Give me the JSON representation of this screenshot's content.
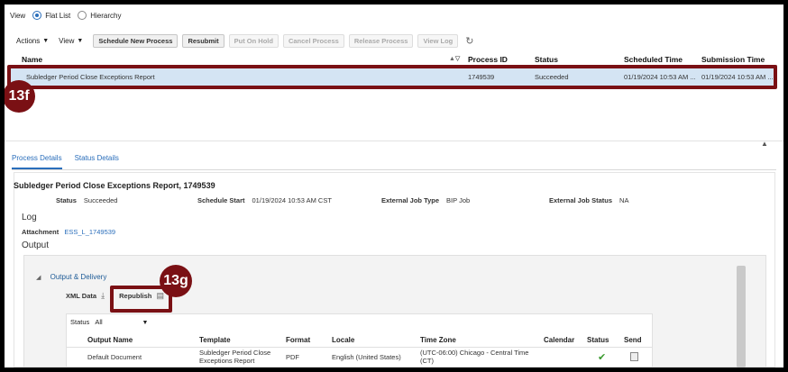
{
  "view": {
    "label": "View",
    "options": [
      {
        "label": "Flat List",
        "selected": true
      },
      {
        "label": "Hierarchy",
        "selected": false
      }
    ]
  },
  "toolbar": {
    "actions_menu": "Actions",
    "view_menu": "View",
    "buttons": [
      {
        "label": "Schedule New Process",
        "enabled": true
      },
      {
        "label": "Resubmit",
        "enabled": true
      },
      {
        "label": "Put On Hold",
        "enabled": false
      },
      {
        "label": "Cancel Process",
        "enabled": false
      },
      {
        "label": "Release Process",
        "enabled": false
      },
      {
        "label": "View Log",
        "enabled": false
      }
    ]
  },
  "grid": {
    "columns": [
      "Name",
      "Process ID",
      "Status",
      "Scheduled Time",
      "Submission Time"
    ],
    "rows": [
      {
        "name": "Subledger Period Close Exceptions Report",
        "process_id": "1749539",
        "status": "Succeeded",
        "scheduled_time": "01/19/2024 10:53 AM ...",
        "submission_time": "01/19/2024 10:53 AM ..."
      }
    ]
  },
  "callouts": {
    "step_f": "13f",
    "step_g": "13g"
  },
  "tabs": [
    {
      "label": "Process Details",
      "active": true
    },
    {
      "label": "Status Details",
      "active": false
    }
  ],
  "details": {
    "title": "Subledger Period Close Exceptions Report, 1749539",
    "status_label": "Status",
    "status_value": "Succeeded",
    "schedule_start_label": "Schedule Start",
    "schedule_start_value": "01/19/2024 10:53 AM CST",
    "external_job_type_label": "External Job Type",
    "external_job_type_value": "BIP Job",
    "external_job_status_label": "External Job Status",
    "external_job_status_value": "NA",
    "log_heading": "Log",
    "attachment_label": "Attachment",
    "attachment_link": "ESS_L_1749539",
    "output_heading": "Output"
  },
  "output_delivery": {
    "title": "Output & Delivery",
    "xml_data": "XML Data",
    "republish": "Republish",
    "status_filter_label": "Status",
    "status_filter_value": "All",
    "columns": [
      "Output Name",
      "Template",
      "Format",
      "Locale",
      "Time Zone",
      "Calendar",
      "Status",
      "Send"
    ],
    "rows": [
      {
        "output_name": "Default Document",
        "template": "Subledger Period Close Exceptions Report",
        "format": "PDF",
        "locale": "English (United States)",
        "time_zone": "(UTC-06:00) Chicago - Central Time (CT)",
        "calendar": "",
        "status": "check-icon",
        "send": "send-icon"
      }
    ]
  },
  "colors": {
    "accent": "#2a6ebb",
    "callout": "#7a1014",
    "selected_row": "#d4e4f3",
    "success": "#3a9a2e"
  }
}
